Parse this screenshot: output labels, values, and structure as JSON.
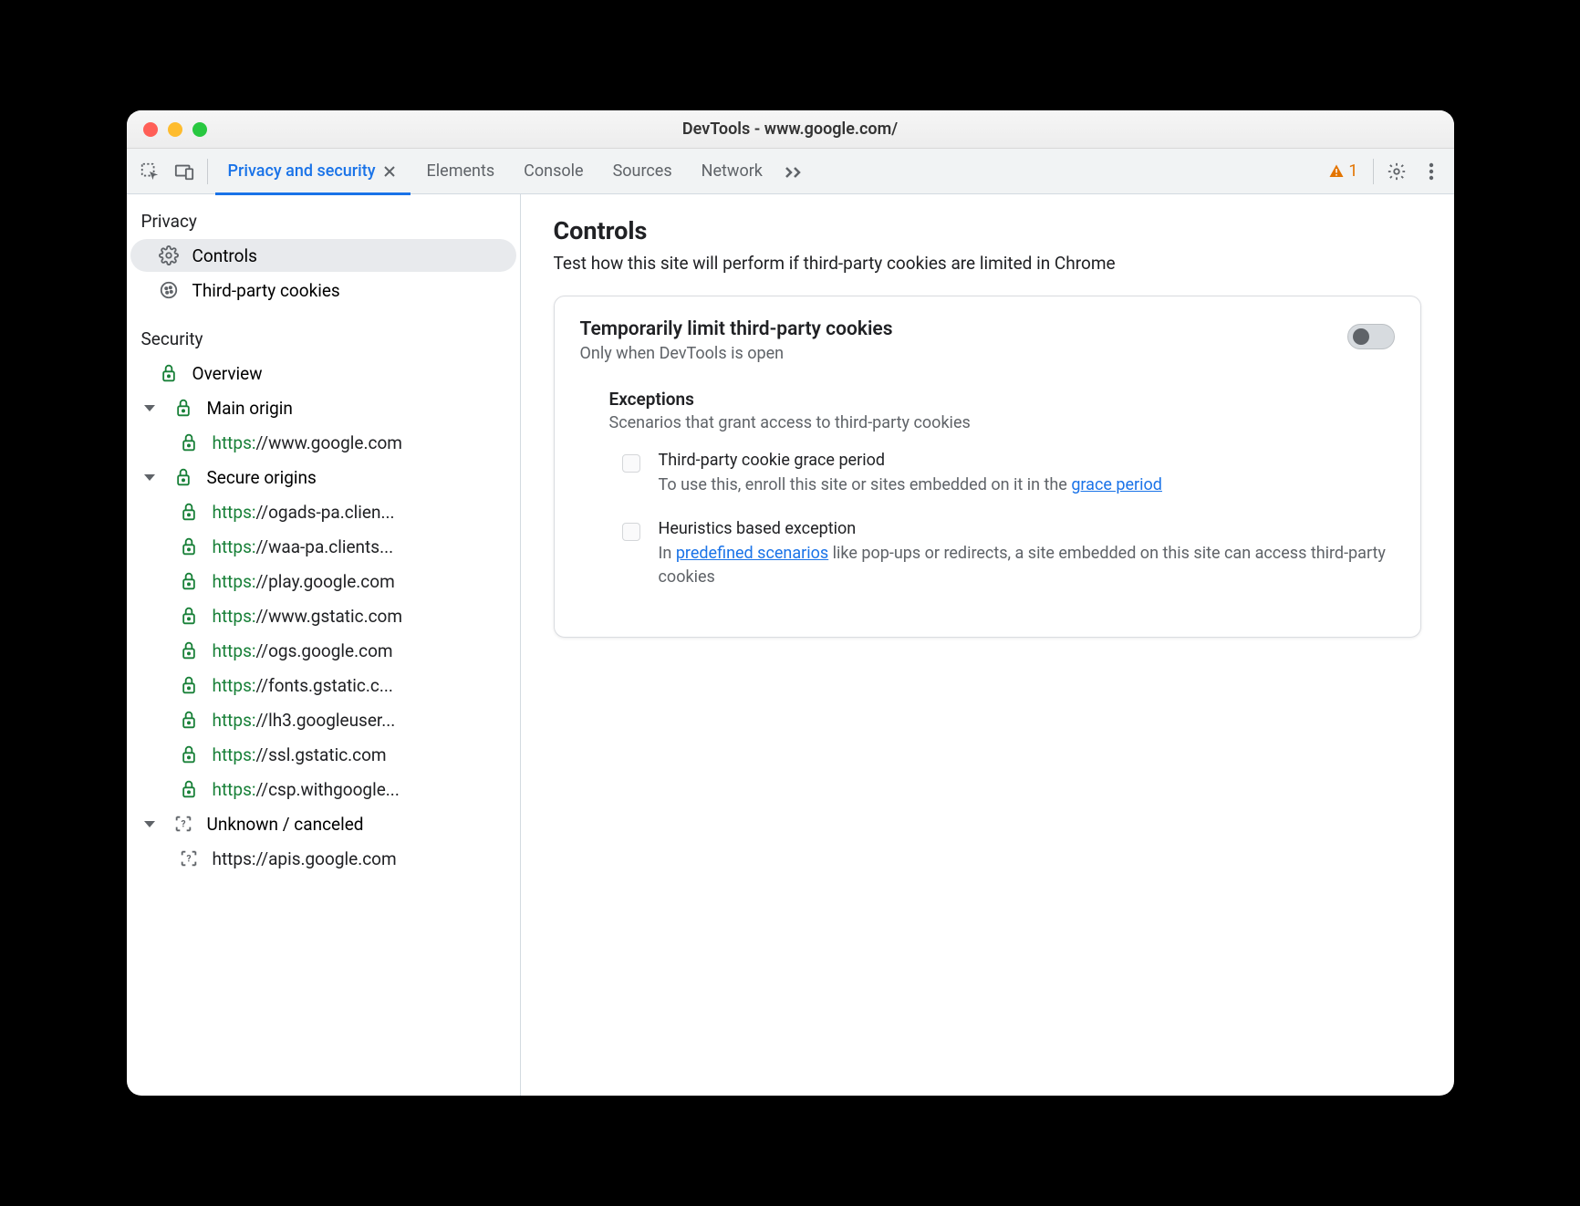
{
  "window": {
    "title": "DevTools - www.google.com/"
  },
  "toolbar": {
    "tabs": [
      {
        "label": "Privacy and security",
        "active": true,
        "closable": true
      },
      {
        "label": "Elements"
      },
      {
        "label": "Console"
      },
      {
        "label": "Sources"
      },
      {
        "label": "Network"
      }
    ],
    "warning_count": "1"
  },
  "sidebar": {
    "privacy": {
      "header": "Privacy",
      "items": [
        {
          "label": "Controls",
          "icon": "gear",
          "selected": true
        },
        {
          "label": "Third-party cookies",
          "icon": "cookie"
        }
      ]
    },
    "security": {
      "header": "Security",
      "overview": {
        "label": "Overview",
        "icon": "lock"
      },
      "main_origin": {
        "label": "Main origin",
        "items": [
          {
            "scheme": "https:",
            "host": "//www.google.com"
          }
        ]
      },
      "secure_origins": {
        "label": "Secure origins",
        "items": [
          {
            "scheme": "https:",
            "host": "//ogads-pa.clien..."
          },
          {
            "scheme": "https:",
            "host": "//waa-pa.clients..."
          },
          {
            "scheme": "https:",
            "host": "//play.google.com"
          },
          {
            "scheme": "https:",
            "host": "//www.gstatic.com"
          },
          {
            "scheme": "https:",
            "host": "//ogs.google.com"
          },
          {
            "scheme": "https:",
            "host": "//fonts.gstatic.c..."
          },
          {
            "scheme": "https:",
            "host": "//lh3.googleuser..."
          },
          {
            "scheme": "https:",
            "host": "//ssl.gstatic.com"
          },
          {
            "scheme": "https:",
            "host": "//csp.withgoogle..."
          }
        ]
      },
      "unknown": {
        "label": "Unknown / canceled",
        "items": [
          {
            "scheme": "",
            "host": "https://apis.google.com"
          }
        ]
      }
    }
  },
  "main": {
    "heading": "Controls",
    "subtitle": "Test how this site will perform if third-party cookies are limited in Chrome",
    "card": {
      "title": "Temporarily limit third-party cookies",
      "subtitle": "Only when DevTools is open",
      "toggle_on": false,
      "exceptions": {
        "title": "Exceptions",
        "subtitle": "Scenarios that grant access to third-party cookies",
        "items": [
          {
            "title": "Third-party cookie grace period",
            "desc_pre": "To use this, enroll this site or sites embedded on it in the ",
            "link": "grace period",
            "desc_post": ""
          },
          {
            "title": "Heuristics based exception",
            "desc_pre": "In ",
            "link": "predefined scenarios",
            "desc_post": " like pop-ups or redirects, a site embedded on this site can access third-party cookies"
          }
        ]
      }
    }
  }
}
